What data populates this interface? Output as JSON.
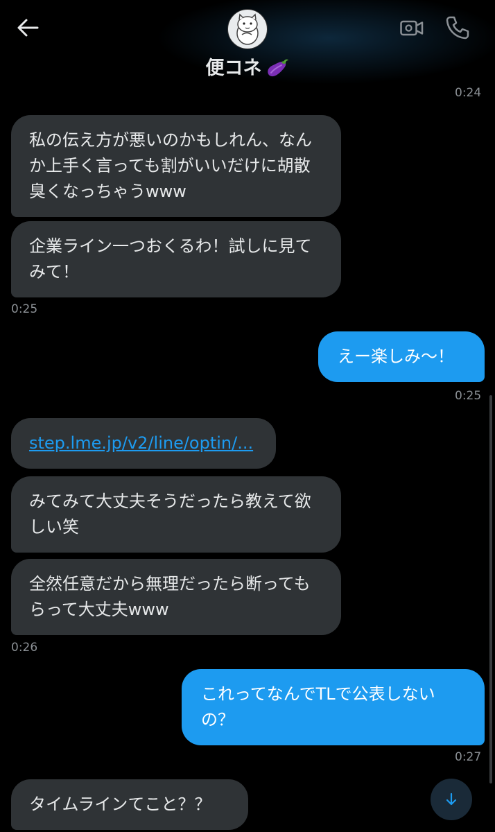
{
  "header": {
    "contact_name": "便コネ",
    "emoji": "eggplant-emoji",
    "icons": [
      "back-arrow-icon",
      "video-call-icon",
      "phone-icon"
    ]
  },
  "colors": {
    "background": "#000000",
    "incoming_bubble": "#2f3336",
    "outgoing_bubble": "#1d9bf0",
    "link": "#1d9bf0",
    "timestamp": "#8b9095"
  },
  "messages": [
    {
      "dir": "in",
      "text": "私の伝え方が悪いのかもしれん、なんか上手く言っても割がいいだけに胡散臭くなっちゃうwww"
    },
    {
      "dir": "in",
      "text": "企業ライン一つおくるわ！試しに見てみて！"
    },
    {
      "dir": "out",
      "text": "えー楽しみ〜！"
    },
    {
      "dir": "in",
      "text": "step.lme.jp/v2/line/optin/...",
      "is_link": true
    },
    {
      "dir": "in",
      "text": "みてみて大丈夫そうだったら教えて欲しい笑"
    },
    {
      "dir": "in",
      "text": "全然任意だから無理だったら断ってもらって大丈夫www"
    },
    {
      "dir": "out",
      "text": "これってなんでTLで公表しないの？"
    },
    {
      "dir": "in",
      "text": "タイムラインてこと？？"
    }
  ],
  "timestamps": [
    "0:24",
    "0:25",
    "0:25",
    "0:26",
    "0:27"
  ],
  "scroll_button": {
    "icon": "arrow-down-icon"
  }
}
